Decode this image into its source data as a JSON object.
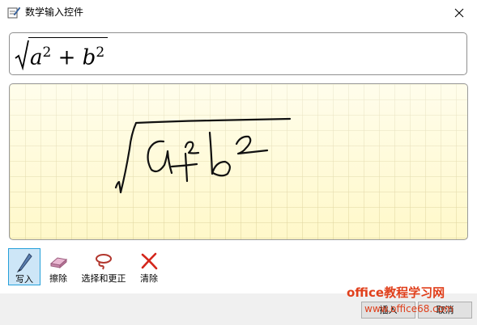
{
  "window": {
    "title": "数学输入控件",
    "icon": "pencil-document-icon",
    "close_icon": "close-icon"
  },
  "preview": {
    "formula_radicand": "a² + b²",
    "formula_parts": {
      "a": "a",
      "exp_a": "2",
      "op": " + ",
      "b": "b",
      "exp_b": "2"
    }
  },
  "canvas": {
    "ink": "handwritten √(a² + b²)"
  },
  "toolbar": {
    "tools": [
      {
        "label": "写入",
        "icon": "pen-icon",
        "active": true
      },
      {
        "label": "擦除",
        "icon": "eraser-icon",
        "active": false
      },
      {
        "label": "选择和更正",
        "icon": "lasso-icon",
        "active": false
      },
      {
        "label": "清除",
        "icon": "clear-x-icon",
        "active": false
      }
    ]
  },
  "footer": {
    "insert_label": "插入",
    "cancel_label": "取消"
  },
  "watermark": {
    "line1": "office教程学习网",
    "line2": "www.office68.com"
  },
  "colors": {
    "canvas_bg": "#fffbd4",
    "grid": "#d6cd96",
    "active_tool": "#cde6f7",
    "watermark": "#e0401c"
  }
}
